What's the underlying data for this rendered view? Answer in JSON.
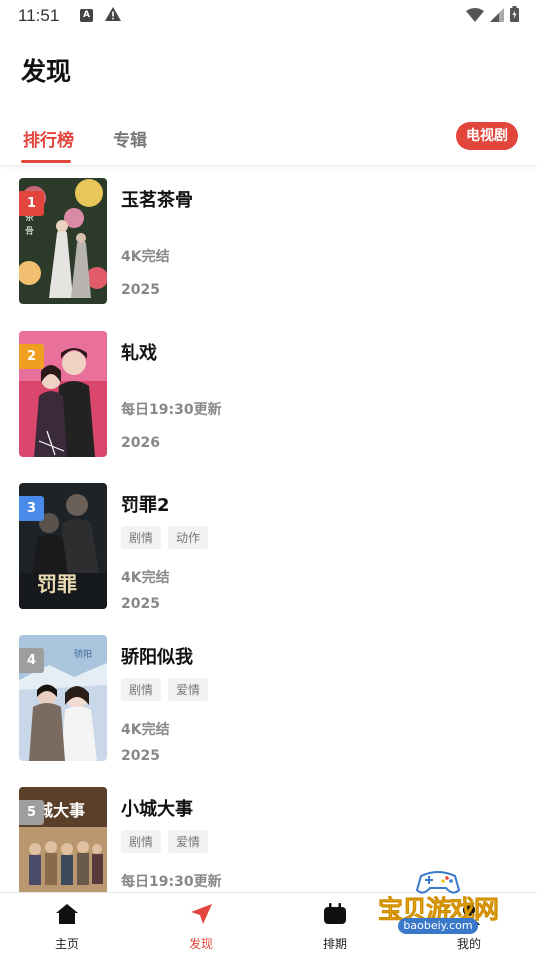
{
  "status_bar": {
    "time": "11:51",
    "notif_letter": "A"
  },
  "header": {
    "title": "发现"
  },
  "tabs": {
    "items": [
      "排行榜",
      "专辑"
    ],
    "active_index": 0,
    "chip": "电视剧"
  },
  "colors": {
    "accent": "#e2453c",
    "rank1": "#e2453c",
    "rank2": "#f0a020",
    "rank3": "#4a8ae8",
    "rank_other": "#9e9e9e"
  },
  "list": [
    {
      "rank": "1",
      "title": "玉茗茶骨",
      "tags": [],
      "status": "4K完结",
      "year": "2025"
    },
    {
      "rank": "2",
      "title": "轧戏",
      "tags": [],
      "status": "每日19:30更新",
      "year": "2026"
    },
    {
      "rank": "3",
      "title": "罚罪2",
      "tags": [
        "剧情",
        "动作"
      ],
      "status": "4K完结",
      "year": "2025"
    },
    {
      "rank": "4",
      "title": "骄阳似我",
      "tags": [
        "剧情",
        "爱情"
      ],
      "status": "4K完结",
      "year": "2025"
    },
    {
      "rank": "5",
      "title": "小城大事",
      "tags": [
        "剧情",
        "爱情"
      ],
      "status": "每日19:30更新",
      "year": ""
    }
  ],
  "poster_text": {
    "item5": "城大事"
  },
  "bottom_nav": [
    {
      "label": "主页",
      "icon": "home-icon"
    },
    {
      "label": "发现",
      "icon": "discover-icon"
    },
    {
      "label": "排期",
      "icon": "schedule-icon"
    },
    {
      "label": "我的",
      "icon": "profile-icon"
    }
  ],
  "watermark": {
    "text": "宝贝游戏网",
    "url": "baobeiy.com"
  }
}
